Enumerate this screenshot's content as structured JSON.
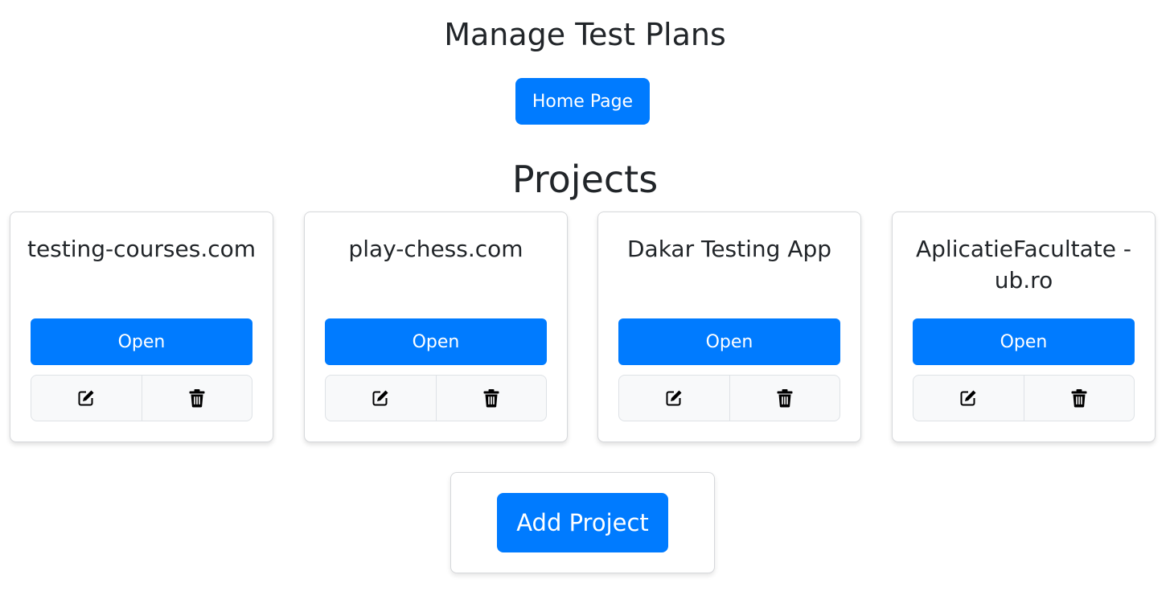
{
  "header": {
    "title": "Manage Test Plans",
    "home_label": "Home Page"
  },
  "section": {
    "title": "Projects"
  },
  "projects": [
    {
      "name": "testing-courses.com",
      "open_label": "Open"
    },
    {
      "name": "play-chess.com",
      "open_label": "Open"
    },
    {
      "name": "Dakar Testing App",
      "open_label": "Open"
    },
    {
      "name": "AplicatieFacultate - ub.ro",
      "open_label": "Open"
    }
  ],
  "actions": {
    "edit_icon": "edit-icon",
    "delete_icon": "trash-icon"
  },
  "add_project_label": "Add Project",
  "colors": {
    "primary": "#007bff",
    "text": "#212529",
    "border": "#d6d8db",
    "button_group_bg": "#f8f9fa"
  }
}
